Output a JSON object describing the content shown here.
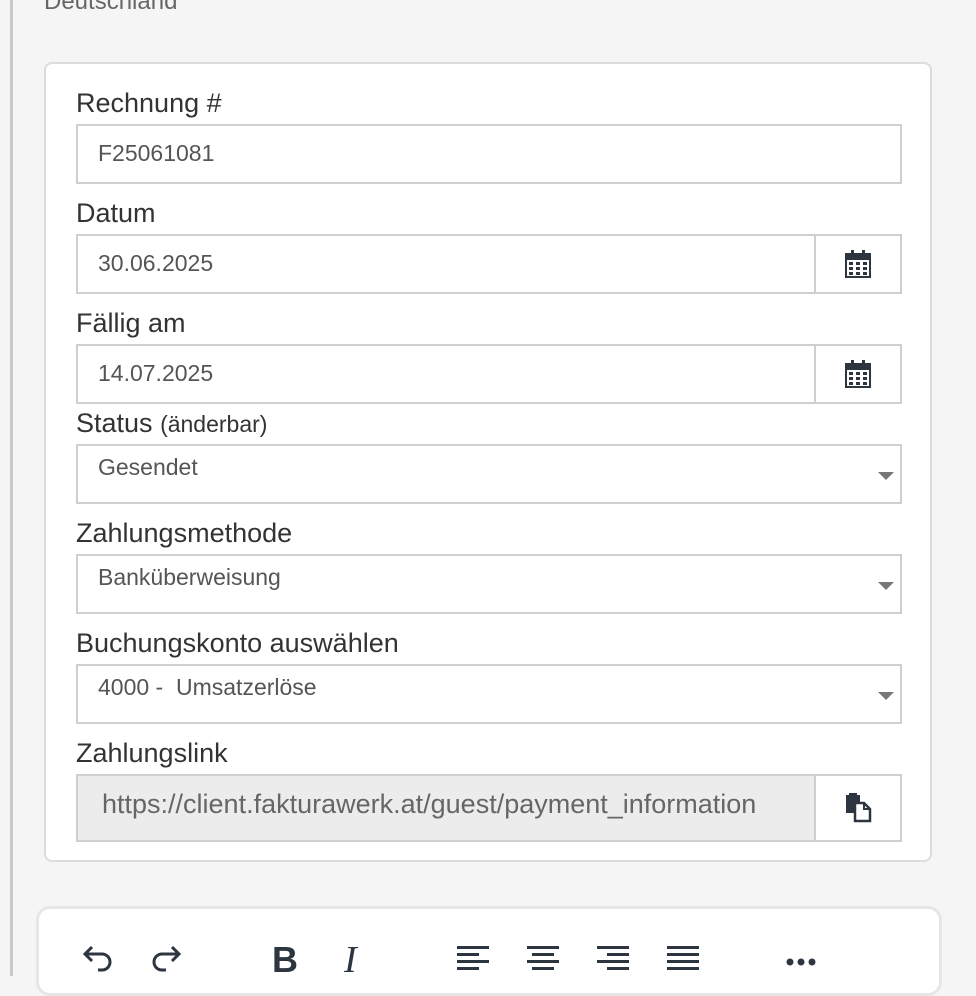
{
  "address": {
    "country": "Deutschland"
  },
  "invoice_form": {
    "invoice_number": {
      "label": "Rechnung #",
      "value": "F25061081"
    },
    "date": {
      "label": "Datum",
      "value": "30.06.2025",
      "icon": "calendar-icon"
    },
    "due_date": {
      "label": "Fällig am",
      "value": "14.07.2025",
      "icon": "calendar-icon"
    },
    "status": {
      "label": "Status",
      "hint": "(änderbar)",
      "value": "Gesendet"
    },
    "payment_method": {
      "label": "Zahlungsmethode",
      "value": "Banküberweisung"
    },
    "booking_account": {
      "label": "Buchungskonto auswählen",
      "value": "4000 -  Umsatzerlöse"
    },
    "payment_link": {
      "label": "Zahlungslink",
      "value": "https://client.fakturawerk.at/guest/payment_information",
      "icon": "copy-icon"
    }
  },
  "editor_toolbar": {
    "tools": [
      "undo-icon",
      "redo-icon",
      "bold-icon",
      "italic-icon",
      "align-left-icon",
      "align-center-icon",
      "align-right-icon",
      "align-justify-icon",
      "more-icon"
    ]
  },
  "colors": {
    "icon": "#2d3540",
    "border": "#cfcfcf",
    "readonly_bg": "#ececec"
  }
}
